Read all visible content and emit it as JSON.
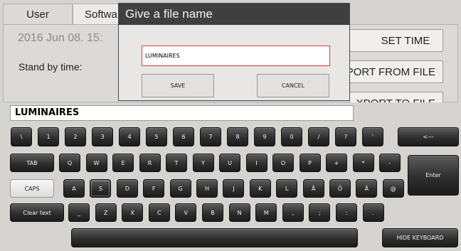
{
  "tabs": [
    {
      "label": "User"
    },
    {
      "label": "Softwa"
    }
  ],
  "background": {
    "datetime": "2016 Jun 08. 15:",
    "standby_label": "Stand by time:",
    "set_time_label": "SET TIME",
    "import_label": "PORT FROM FILE",
    "export_label": "XPORT TO FILE"
  },
  "dialog": {
    "title": "Give a file name",
    "input_value": "LUMINAIRES",
    "save_label": "SAVE",
    "cancel_label": "CANCEL"
  },
  "keyboard": {
    "text_value": "LUMINAIRES",
    "row1": [
      "\\",
      "1",
      "2",
      "3",
      "4",
      "5",
      "6",
      "7",
      "8",
      "9",
      "0",
      "/",
      "?",
      "'"
    ],
    "backspace_label": "<---",
    "tab_label": "TAB",
    "row2": [
      "Q",
      "W",
      "E",
      "R",
      "T",
      "Y",
      "U",
      "I",
      "O",
      "P",
      "+",
      "*",
      "-"
    ],
    "enter_label": "Enter",
    "caps_label": "CAPS",
    "row3": [
      "A",
      "S",
      "D",
      "F",
      "G",
      "H",
      "J",
      "K",
      "L",
      "Å",
      "Ö",
      "Ä",
      "@"
    ],
    "clear_label": "Clear text",
    "row4": [
      "_",
      "Z",
      "X",
      "C",
      "V",
      "B",
      "N",
      "M",
      ",",
      ";",
      ":",
      "."
    ],
    "hide_label": "HIDE KEYBOARD"
  }
}
